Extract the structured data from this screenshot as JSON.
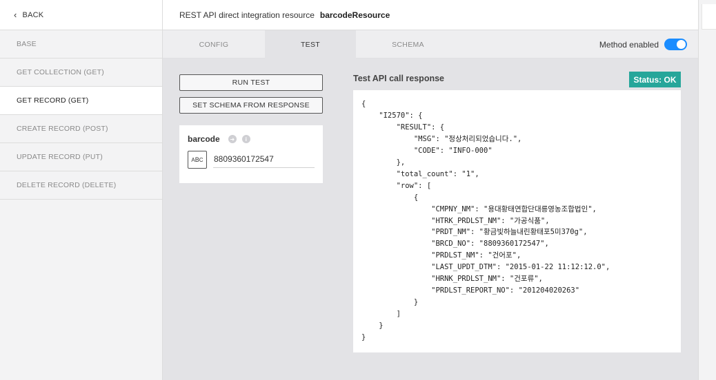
{
  "sidebar": {
    "back_label": "BACK",
    "items": [
      {
        "label": "BASE"
      },
      {
        "label": "GET COLLECTION (GET)"
      },
      {
        "label": "GET RECORD (GET)"
      },
      {
        "label": "CREATE RECORD (POST)"
      },
      {
        "label": "UPDATE RECORD (PUT)"
      },
      {
        "label": "DELETE RECORD (DELETE)"
      }
    ],
    "active_index": 2
  },
  "header": {
    "prefix": "REST API direct integration resource",
    "resource_name": "barcodeResource"
  },
  "tabs": [
    {
      "label": "CONFIG"
    },
    {
      "label": "TEST"
    },
    {
      "label": "SCHEMA"
    }
  ],
  "active_tab_index": 1,
  "method_toggle": {
    "label": "Method enabled",
    "enabled": true
  },
  "buttons": {
    "run_test": "RUN TEST",
    "set_schema": "SET SCHEMA FROM RESPONSE"
  },
  "param": {
    "name": "barcode",
    "type_icon": "abc-text-type-icon",
    "value": "8809360172547"
  },
  "response": {
    "title": "Test API call response",
    "status": "Status: OK",
    "body": "{\n    \"I2570\": {\n        \"RESULT\": {\n            \"MSG\": \"정상처리되었습니다.\",\n            \"CODE\": \"INFO-000\"\n        },\n        \"total_count\": \"1\",\n        \"row\": [\n            {\n                \"CMPNY_NM\": \"용대황태연합단대릉영농조합법인\",\n                \"HTRK_PRDLST_NM\": \"가공식품\",\n                \"PRDT_NM\": \"황금빛하늘내린황태포5미370g\",\n                \"BRCD_NO\": \"8809360172547\",\n                \"PRDLST_NM\": \"건어포\",\n                \"LAST_UPDT_DTM\": \"2015-01-22 11:12:12.0\",\n                \"HRNK_PRDLST_NM\": \"건포류\",\n                \"PRDLST_REPORT_NO\": \"201204020263\"\n            }\n        ]\n    }\n}"
  },
  "colors": {
    "accent": "#1a8cff",
    "status_ok": "#26a69a"
  }
}
